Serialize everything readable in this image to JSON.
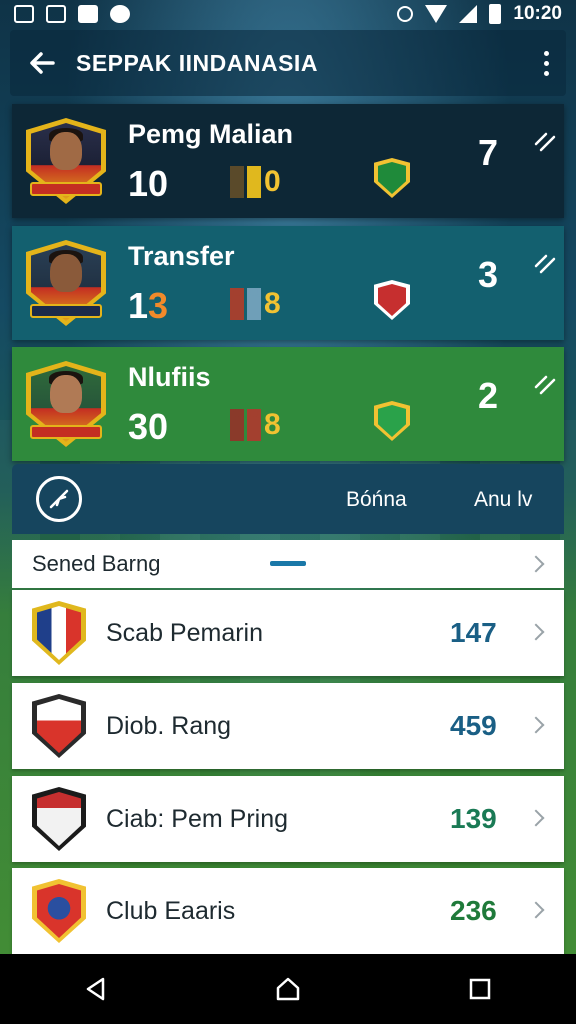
{
  "status_bar": {
    "time": "10:20"
  },
  "app_bar": {
    "title": "SEPPAK IINDANASIA",
    "back_icon": "arrow-left-icon",
    "menu_icon": "more-vert-icon"
  },
  "players": [
    {
      "name": "Pemg Malian",
      "number": "10",
      "stat_value": "0",
      "score": "7",
      "card_color": "#0d2736",
      "badge_colors": [
        "#1f8a3a",
        "#f1c232"
      ]
    },
    {
      "name": "Transfer",
      "number_main": "1",
      "number_accent": "3",
      "stat_value": "8",
      "score": "3",
      "card_color": "#13606f",
      "badge_colors": [
        "#c62f2f",
        "#ffffff"
      ]
    },
    {
      "name": "Nlufiis",
      "number": "30",
      "stat_value": "8",
      "score": "2",
      "card_color": "#2f8a3c",
      "badge_colors": [
        "#2aa24a",
        "#f1c232"
      ]
    }
  ],
  "tabs": {
    "icon": "compass-icon",
    "tab_1": "Bóńna",
    "tab_2": "Anu lv"
  },
  "list": {
    "header": "Sened Barng",
    "items": [
      {
        "label": "Scab Pemarin",
        "value": "147",
        "value_color": "#1a5f85",
        "crest_colors": [
          "#1f3f8a",
          "#d9342b"
        ]
      },
      {
        "label": "Diob. Rang",
        "value": "459",
        "value_color": "#1a5f85",
        "crest_colors": [
          "#2a2a2a",
          "#d9342b"
        ]
      },
      {
        "label": "Ciab: Pem Pring",
        "value": "139",
        "value_color": "#1a7a55",
        "crest_colors": [
          "#1b1b1b",
          "#c62f2f"
        ]
      },
      {
        "label": "Club Eaaris",
        "value": "236",
        "value_color": "#1f7a3a",
        "crest_colors": [
          "#d9342b",
          "#f1c232"
        ]
      }
    ]
  },
  "nav_bar": {
    "back": "nav-back-icon",
    "home": "nav-home-icon",
    "recents": "nav-recents-icon"
  }
}
